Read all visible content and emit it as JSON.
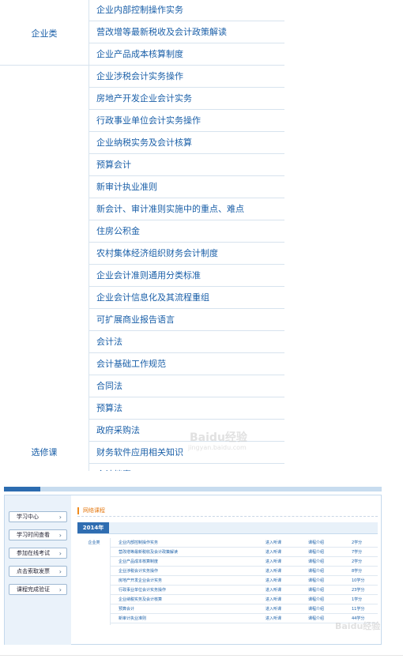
{
  "course_list": {
    "categories": [
      {
        "label": "企业类"
      },
      {
        "label": "选修课"
      }
    ],
    "rows": [
      "企业内部控制操作实务",
      "营改增等最新税收及会计政策解读",
      "企业产品成本核算制度",
      "企业涉税会计实务操作",
      "房地产开发企业会计实务",
      "行政事业单位会计实务操作",
      "企业纳税实务及会计核算",
      "预算会计",
      "新审计执业准则",
      "新会计、审计准则实施中的重点、难点",
      "住房公积金",
      "农村集体经济组织财务会计制度",
      "企业会计准则通用分类标准",
      "企业会计信息化及其流程重组",
      "可扩展商业报告语言",
      "会计法",
      "会计基础工作规范",
      "合同法",
      "预算法",
      "政府采购法",
      "财务软件应用相关知识",
      "会计档案"
    ]
  },
  "screenshot": {
    "sidebar": [
      {
        "label": "学习中心"
      },
      {
        "label": "学习时间查看"
      },
      {
        "label": "参加在线考试"
      },
      {
        "label": "点击索取发票"
      },
      {
        "label": "课程完成验证"
      }
    ],
    "section_title": "网络课程",
    "year_tab": "2014年",
    "category": "企业类",
    "rows": [
      {
        "name": "企业内部控制操作实务",
        "action": "进入听课",
        "intro": "课程介绍",
        "credit": "2学分"
      },
      {
        "name": "营改增等最新税收及会计政策解读",
        "action": "进入听课",
        "intro": "课程介绍",
        "credit": "7学分"
      },
      {
        "name": "企业产品成本核算制度",
        "action": "进入听课",
        "intro": "课程介绍",
        "credit": "2学分"
      },
      {
        "name": "企业涉税会计实务操作",
        "action": "进入听课",
        "intro": "课程介绍",
        "credit": "8学分"
      },
      {
        "name": "房地产开发企业会计实务",
        "action": "进入听课",
        "intro": "课程介绍",
        "credit": "10学分"
      },
      {
        "name": "行政事业单位会计实务操作",
        "action": "进入听课",
        "intro": "课程介绍",
        "credit": "23学分"
      },
      {
        "name": "企业纳税实务及会计核算",
        "action": "进入听课",
        "intro": "课程介绍",
        "credit": "1学分"
      },
      {
        "name": "预算会计",
        "action": "进入听课",
        "intro": "课程介绍",
        "credit": "11学分"
      },
      {
        "name": "新审计执业准则",
        "action": "进入听课",
        "intro": "课程介绍",
        "credit": "44学分"
      }
    ]
  },
  "watermark": {
    "logo": "Baidu经验",
    "url": "jingyan.baidu.com"
  },
  "icons": {
    "chevron": "chevron-right-icon"
  },
  "colors": {
    "link": "#1a5fa8",
    "accent_orange": "#f08b1d",
    "tab_blue": "#2f6db1"
  }
}
